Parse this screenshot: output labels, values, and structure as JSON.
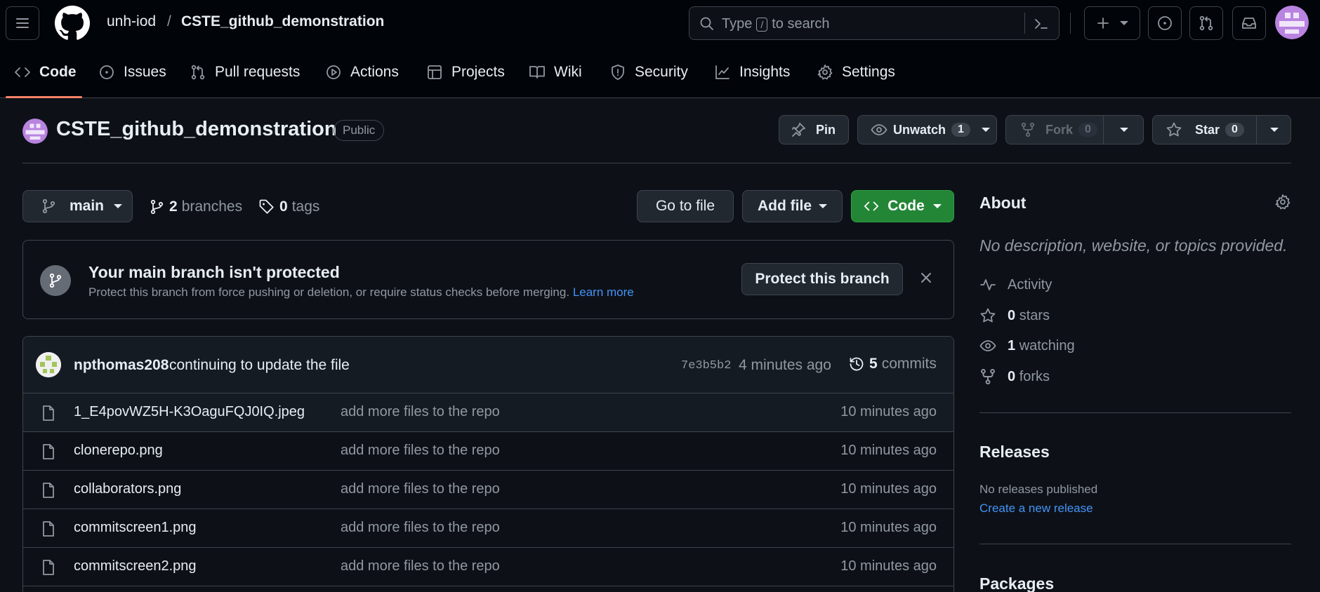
{
  "header": {
    "owner": "unh-iod",
    "separator": "/",
    "repo": "CSTE_github_demonstration",
    "search_prefix": "Type",
    "search_key": "/",
    "search_suffix": "to search",
    "plus_label": "+"
  },
  "nav": {
    "tabs": [
      {
        "label": "Code",
        "icon": "code-icon"
      },
      {
        "label": "Issues",
        "icon": "issue-icon"
      },
      {
        "label": "Pull requests",
        "icon": "pull-request-icon"
      },
      {
        "label": "Actions",
        "icon": "play-icon"
      },
      {
        "label": "Projects",
        "icon": "table-icon"
      },
      {
        "label": "Wiki",
        "icon": "book-icon"
      },
      {
        "label": "Security",
        "icon": "shield-icon"
      },
      {
        "label": "Insights",
        "icon": "graph-icon"
      },
      {
        "label": "Settings",
        "icon": "gear-icon"
      }
    ]
  },
  "repo_header": {
    "name": "CSTE_github_demonstration",
    "visibility": "Public",
    "pin_label": "Pin",
    "unwatch_label": "Unwatch",
    "watch_count": "1",
    "fork_label": "Fork",
    "fork_count": "0",
    "star_label": "Star",
    "star_count": "0"
  },
  "controls": {
    "branch": "main",
    "branches_count": "2",
    "branches_label": "branches",
    "tags_count": "0",
    "tags_label": "tags",
    "go_to_file": "Go to file",
    "add_file": "Add file",
    "code_label": "Code"
  },
  "banner": {
    "title": "Your main branch isn't protected",
    "text": "Protect this branch from force pushing or deletion, or require status checks before merging.",
    "link": "Learn more",
    "button": "Protect this branch"
  },
  "latest_commit": {
    "author": "npthomas208",
    "message": "continuing to update the file",
    "sha": "7e3b5b2",
    "time": "4 minutes ago",
    "commits_count": "5",
    "commits_label": "commits"
  },
  "files": [
    {
      "name": "1_E4povWZ5H-K3OaguFQJ0IQ.jpeg",
      "message": "add more files to the repo",
      "time": "10 minutes ago"
    },
    {
      "name": "clonerepo.png",
      "message": "add more files to the repo",
      "time": "10 minutes ago"
    },
    {
      "name": "collaborators.png",
      "message": "add more files to the repo",
      "time": "10 minutes ago"
    },
    {
      "name": "commitscreen1.png",
      "message": "add more files to the repo",
      "time": "10 minutes ago"
    },
    {
      "name": "commitscreen2.png",
      "message": "add more files to the repo",
      "time": "10 minutes ago"
    }
  ],
  "sidebar": {
    "about_title": "About",
    "description": "No description, website, or topics provided.",
    "activity": "Activity",
    "stars_count": "0",
    "stars_label": "stars",
    "watching_count": "1",
    "watching_label": "watching",
    "forks_count": "0",
    "forks_label": "forks",
    "releases_title": "Releases",
    "no_releases": "No releases published",
    "create_release": "Create a new release",
    "packages_title": "Packages"
  },
  "colors": {
    "accent_green": "#238636",
    "link_blue": "#4493f8",
    "tab_underline": "#f78166",
    "avatar_purple": "#b983e0"
  }
}
